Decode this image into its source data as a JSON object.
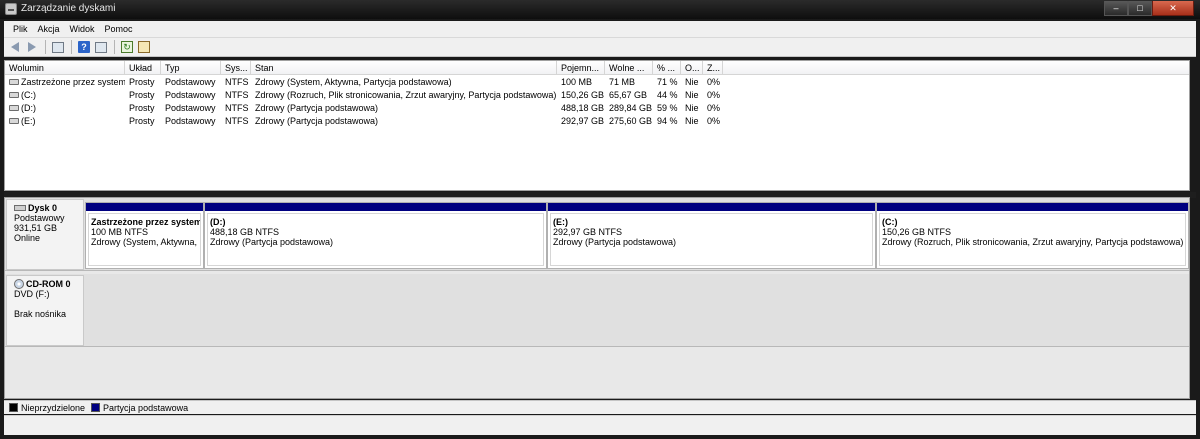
{
  "window": {
    "title": "Zarządzanie dyskami"
  },
  "menu": [
    "Plik",
    "Akcja",
    "Widok",
    "Pomoc"
  ],
  "toolbar": {
    "icons": [
      "back-icon",
      "forward-icon",
      "list-view-icon",
      "help-icon",
      "details-icon",
      "refresh-icon",
      "properties-icon"
    ]
  },
  "columns": [
    "Wolumin",
    "Układ",
    "Typ",
    "Sys...",
    "Stan",
    "Pojemn...",
    "Wolne ...",
    "% ...",
    "O...",
    "Z..."
  ],
  "volumes": [
    {
      "name": "Zastrzeżone przez system",
      "layout": "Prosty",
      "type": "Podstawowy",
      "fs": "NTFS",
      "status": "Zdrowy (System, Aktywna, Partycja podstawowa)",
      "capacity": "100 MB",
      "free": "71 MB",
      "pct": "71 %",
      "ov": "Nie",
      "z": "0%"
    },
    {
      "name": "(C:)",
      "layout": "Prosty",
      "type": "Podstawowy",
      "fs": "NTFS",
      "status": "Zdrowy (Rozruch, Plik stronicowania, Zrzut awaryjny, Partycja podstawowa)",
      "capacity": "150,26 GB",
      "free": "65,67 GB",
      "pct": "44 %",
      "ov": "Nie",
      "z": "0%"
    },
    {
      "name": "(D:)",
      "layout": "Prosty",
      "type": "Podstawowy",
      "fs": "NTFS",
      "status": "Zdrowy (Partycja podstawowa)",
      "capacity": "488,18 GB",
      "free": "289,84 GB",
      "pct": "59 %",
      "ov": "Nie",
      "z": "0%"
    },
    {
      "name": "(E:)",
      "layout": "Prosty",
      "type": "Podstawowy",
      "fs": "NTFS",
      "status": "Zdrowy (Partycja podstawowa)",
      "capacity": "292,97 GB",
      "free": "275,60 GB",
      "pct": "94 %",
      "ov": "Nie",
      "z": "0%"
    }
  ],
  "disks": [
    {
      "name": "Dysk 0",
      "type": "Podstawowy",
      "size": "931,51 GB",
      "state": "Online",
      "partitions": [
        {
          "title": "Zastrzeżone przez system",
          "size": "100 MB NTFS",
          "status": "Zdrowy (System, Aktywna,"
        },
        {
          "title": "(D:)",
          "size": "488,18 GB NTFS",
          "status": "Zdrowy (Partycja podstawowa)"
        },
        {
          "title": "(E:)",
          "size": "292,97 GB NTFS",
          "status": "Zdrowy (Partycja podstawowa)"
        },
        {
          "title": "(C:)",
          "size": "150,26 GB NTFS",
          "status": "Zdrowy (Rozruch, Plik stronicowania, Zrzut awaryjny, Partycja podstawowa)"
        }
      ]
    },
    {
      "name": "CD-ROM 0",
      "type": "DVD (F:)",
      "state": "Brak nośnika"
    }
  ],
  "legend": [
    {
      "label": "Nieprzydzielone",
      "color": "#000000"
    },
    {
      "label": "Partycja podstawowa",
      "color": "#000080"
    }
  ],
  "colors": {
    "primary_partition": "#000080",
    "unallocated": "#000000"
  }
}
